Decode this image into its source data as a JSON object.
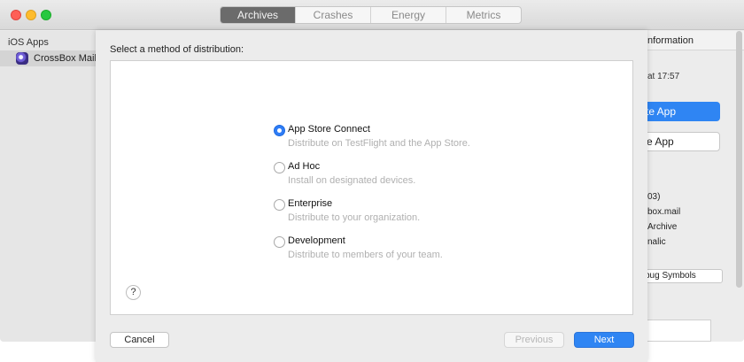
{
  "segmented": {
    "tabs": [
      {
        "label": "Archives",
        "active": true
      },
      {
        "label": "Crashes",
        "active": false
      },
      {
        "label": "Energy",
        "active": false
      },
      {
        "label": "Metrics",
        "active": false
      }
    ]
  },
  "sidebar": {
    "header": "iOS Apps",
    "items": [
      {
        "label": "CrossBox Mail",
        "icon": "app-icon",
        "selected": true
      }
    ]
  },
  "inspector": {
    "title": "nformation",
    "time": "at 17:57",
    "primary_button": "te App",
    "secondary_button": "e App",
    "lines": [
      "03)",
      "box.mail",
      "Archive",
      "nalic"
    ],
    "debug_button": "bug Symbols"
  },
  "sheet": {
    "title": "Select a method of distribution:",
    "options": [
      {
        "label": "App Store Connect",
        "description": "Distribute on TestFlight and the App Store.",
        "selected": true
      },
      {
        "label": "Ad Hoc",
        "description": "Install on designated devices.",
        "selected": false
      },
      {
        "label": "Enterprise",
        "description": "Distribute to your organization.",
        "selected": false
      },
      {
        "label": "Development",
        "description": "Distribute to members of your team.",
        "selected": false
      }
    ],
    "help_label": "?",
    "cancel_label": "Cancel",
    "previous_label": "Previous",
    "next_label": "Next"
  },
  "colors": {
    "accent": "#2f85f3",
    "active_segment": "#6b6b6b",
    "disabled_text": "#b6b6b6"
  }
}
